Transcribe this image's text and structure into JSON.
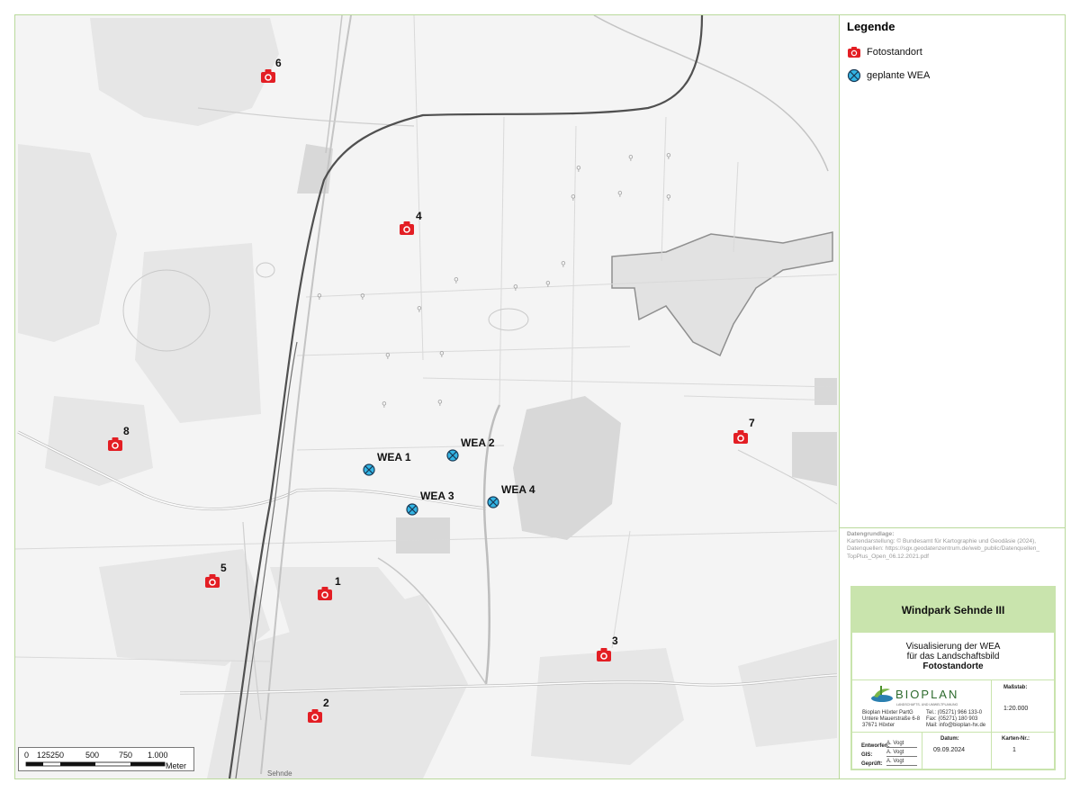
{
  "legend": {
    "title": "Legende",
    "items": [
      {
        "label": "Fotostandort",
        "icon": "camera-icon",
        "color": "#e31e24"
      },
      {
        "label": "geplante WEA",
        "icon": "crossed-circle-icon",
        "color": "#33b5e5"
      }
    ]
  },
  "photo_sites": [
    {
      "label": "1"
    },
    {
      "label": "2"
    },
    {
      "label": "3"
    },
    {
      "label": "4"
    },
    {
      "label": "5"
    },
    {
      "label": "6"
    },
    {
      "label": "7"
    },
    {
      "label": "8"
    }
  ],
  "turbines": [
    {
      "label": "WEA 1"
    },
    {
      "label": "WEA 2"
    },
    {
      "label": "WEA 3"
    },
    {
      "label": "WEA 4"
    }
  ],
  "source": {
    "heading": "Datengrundlage:",
    "lines": [
      "Kartendarstellung: © Bundesamt für Kartographie und Geodäsie (2024),",
      "Datenquellen: https://sgx.geodatenzentrum.de/web_public/Datenquellen_",
      "TopPlus_Open_06.12.2021.pdf"
    ]
  },
  "title_block": {
    "project": "Windpark Sehnde III",
    "desc1": "Visualisierung der WEA",
    "desc2": "für das Landschaftsbild",
    "desc3": "Fotostandorte",
    "logo_text": "BIOPLAN",
    "logo_sub": "LANDSCHAFTS- UND UMWELTPLANUNG",
    "company": [
      "Bioplan Höxter PartG",
      "Untere Mauerstraße 6-8",
      "37671 Höxter"
    ],
    "contact": [
      "Tel.: (05271) 966 133-0",
      "Fax: (05271) 180 903",
      "Mail: info@bioplan-hx.de"
    ],
    "scale_label": "Maßstab:",
    "scale_value": "1:20.000",
    "roles": [
      {
        "role": "Entworfen:",
        "name": "A. Vogt"
      },
      {
        "role": "GIS:",
        "name": "A. Vogt"
      },
      {
        "role": "Geprüft:",
        "name": "A. Vogt"
      }
    ],
    "date_label": "Datum:",
    "date_value": "09.09.2024",
    "map_no_label": "Karten-Nr.:",
    "map_no_value": "1"
  },
  "scalebar": {
    "ticks": [
      "0",
      "125",
      "250",
      "500",
      "750",
      "1.000"
    ],
    "unit": "Meter"
  },
  "map_labels": {
    "town_south": "Sehnde"
  }
}
